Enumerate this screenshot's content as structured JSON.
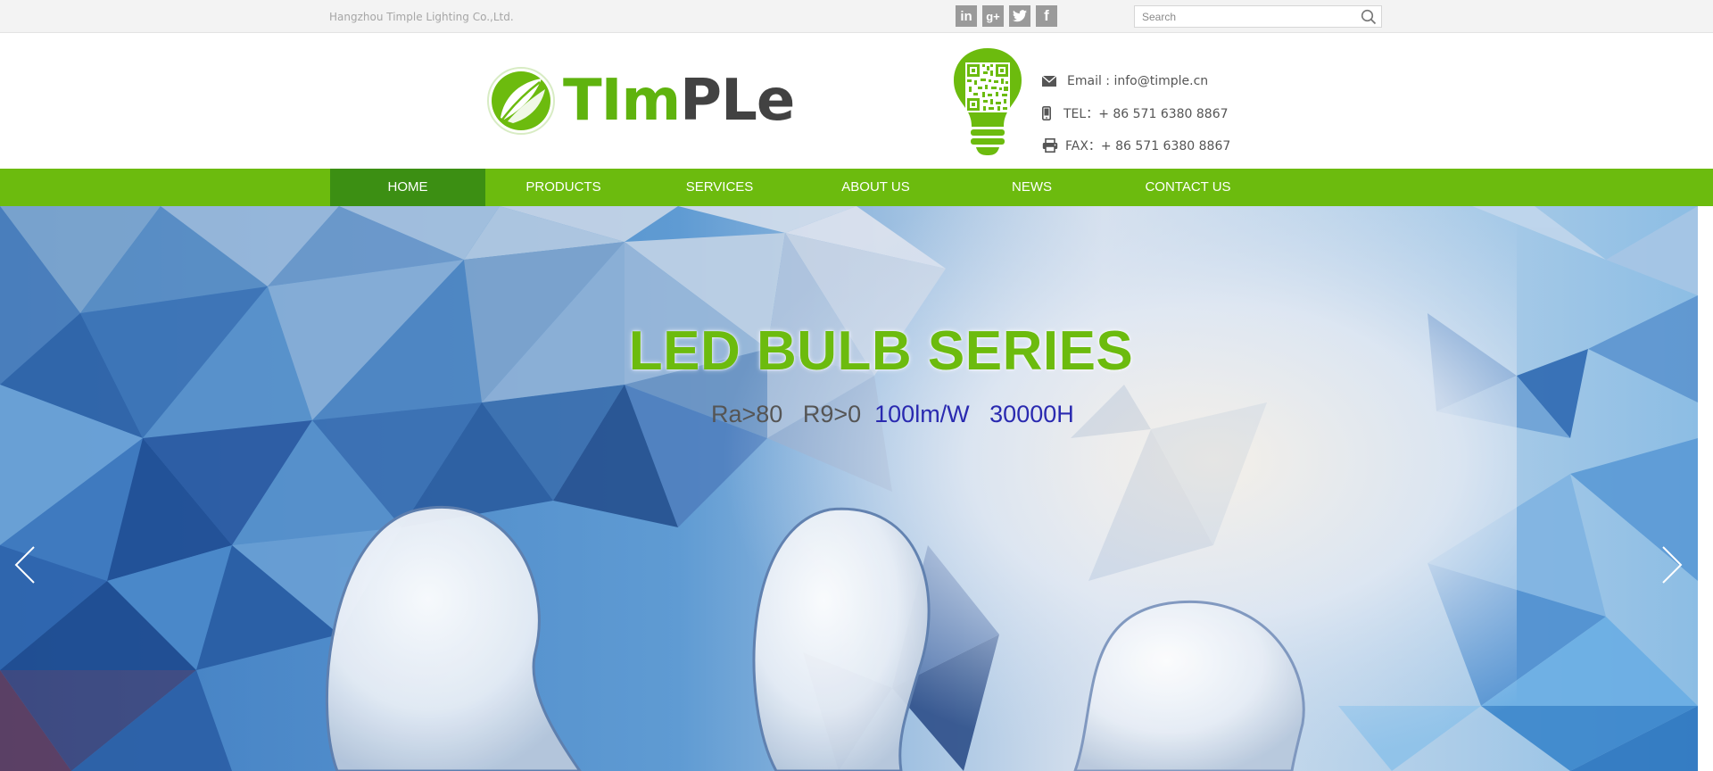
{
  "topbar": {
    "company": "Hangzhou Timple Lighting Co.,Ltd.",
    "social": [
      {
        "icon": "linkedin-icon",
        "label": "in"
      },
      {
        "icon": "google-plus-icon",
        "label": "g+"
      },
      {
        "icon": "twitter-icon",
        "label": ""
      },
      {
        "icon": "facebook-icon",
        "label": "f"
      }
    ],
    "search_placeholder": "Search"
  },
  "header": {
    "logo_text_green": "TIm",
    "logo_text_dark": "PLe",
    "email": "Email : info@timple.cn",
    "tel": "TEL：+ 86 571 6380  8867",
    "fax": "FAX：+ 86 571 6380  8867"
  },
  "nav": {
    "items": [
      "HOME",
      "PRODUCTS",
      "SERVICES",
      "ABOUT US",
      "NEWS",
      "CONTACT US"
    ],
    "active": "HOME"
  },
  "banner": {
    "title": "LED BULB SERIES",
    "spec_gray": "Ra>80   R9>0",
    "spec_blue": "100lm/W   30000H"
  },
  "colors": {
    "brand_green": "#6cbb0e",
    "nav_active": "#3c8f13",
    "spec_blue": "#2a2ab0"
  }
}
